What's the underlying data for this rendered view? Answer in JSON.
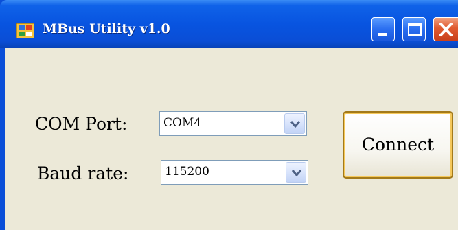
{
  "window": {
    "title": "MBus Utility v1.0",
    "icons": {
      "app": "app-icon",
      "minimize": "minimize-icon",
      "maximize": "maximize-icon",
      "close": "close-icon"
    }
  },
  "form": {
    "com_port": {
      "label": "COM Port:",
      "value": "COM4"
    },
    "baud_rate": {
      "label": "Baud rate:",
      "value": "115200"
    },
    "connect_label": "Connect"
  },
  "colors": {
    "titlebar": "#0a4ed6",
    "client_bg": "#ece9d8",
    "close_button": "#e05a30",
    "focus_border": "#f5c85a"
  }
}
